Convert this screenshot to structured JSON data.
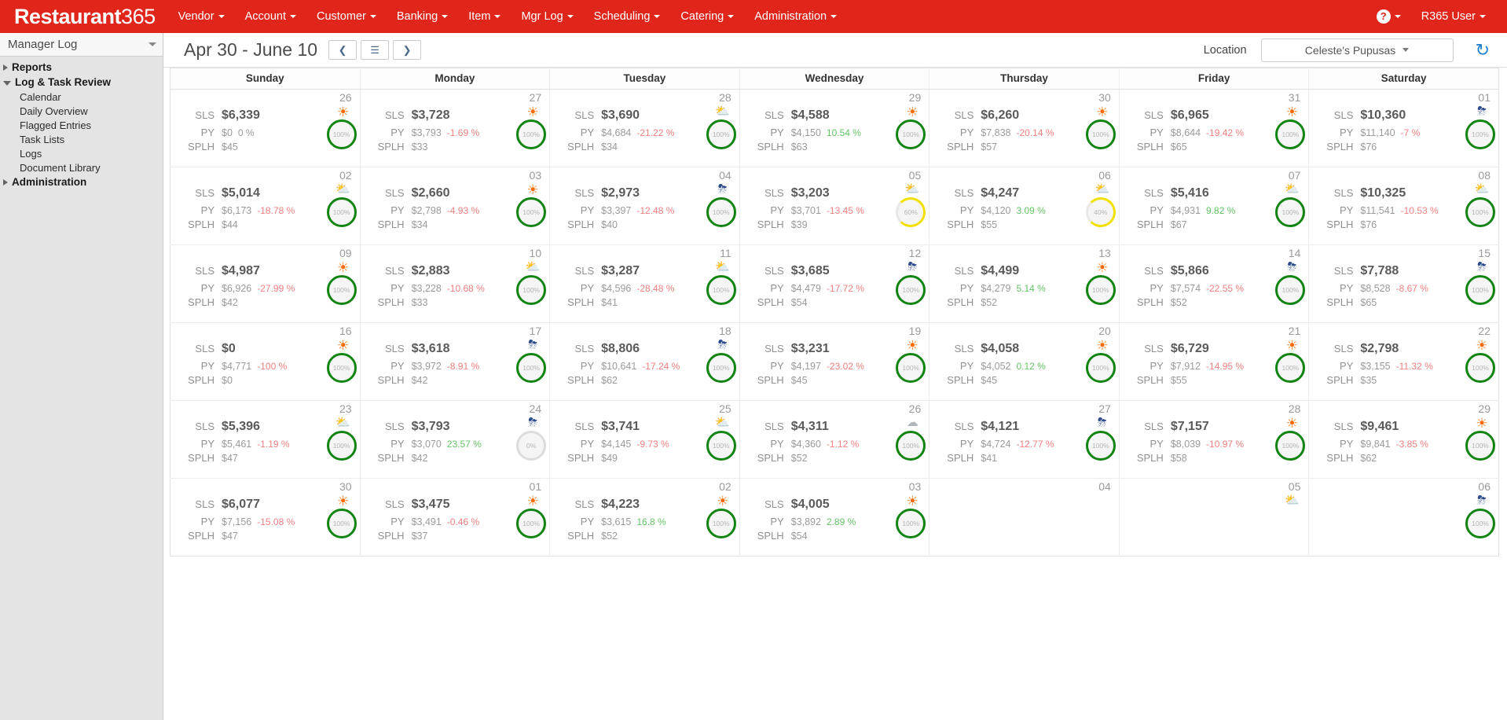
{
  "brand": {
    "bold": "Restaurant",
    "light": "365"
  },
  "topnav": {
    "items": [
      {
        "label": "Vendor"
      },
      {
        "label": "Account"
      },
      {
        "label": "Customer"
      },
      {
        "label": "Banking"
      },
      {
        "label": "Item"
      },
      {
        "label": "Mgr Log"
      },
      {
        "label": "Scheduling"
      },
      {
        "label": "Catering"
      },
      {
        "label": "Administration"
      }
    ],
    "help_glyph": "?",
    "user": "R365 User"
  },
  "sidebar": {
    "module": "Manager Log",
    "tree": [
      {
        "label": "Reports",
        "type": "group",
        "open": false
      },
      {
        "label": "Log & Task Review",
        "type": "group",
        "open": true
      },
      {
        "label": "Calendar",
        "type": "child"
      },
      {
        "label": "Daily Overview",
        "type": "child"
      },
      {
        "label": "Flagged Entries",
        "type": "child"
      },
      {
        "label": "Task Lists",
        "type": "child"
      },
      {
        "label": "Logs",
        "type": "child"
      },
      {
        "label": "Document Library",
        "type": "child"
      },
      {
        "label": "Administration",
        "type": "group",
        "open": false
      }
    ]
  },
  "toolbar": {
    "date_range": "Apr 30 - June 10",
    "prev_glyph": "❮",
    "calendar_glyph": "☰",
    "next_glyph": "❯",
    "location_label": "Location",
    "location_value": "Celeste's Pupusas",
    "refresh_glyph": "↻"
  },
  "calendar": {
    "day_headers": [
      "Sunday",
      "Monday",
      "Tuesday",
      "Wednesday",
      "Thursday",
      "Friday",
      "Saturday"
    ],
    "labels": {
      "sls": "SLS",
      "py": "PY",
      "splh": "SPLH"
    },
    "weeks": [
      [
        {
          "day": "26",
          "wx": "sun",
          "ring": "green",
          "ring_text": "100%",
          "sls": "$6,339",
          "py": "$0",
          "pct": "0 %",
          "pct_dir": "zero",
          "splh": "$45"
        },
        {
          "day": "27",
          "wx": "sun",
          "ring": "green",
          "ring_text": "100%",
          "sls": "$3,728",
          "py": "$3,793",
          "pct": "-1.69 %",
          "pct_dir": "neg",
          "splh": "$33"
        },
        {
          "day": "28",
          "wx": "cloud-sun",
          "ring": "green",
          "ring_text": "100%",
          "sls": "$3,690",
          "py": "$4,684",
          "pct": "-21.22 %",
          "pct_dir": "neg",
          "splh": "$34"
        },
        {
          "day": "29",
          "wx": "sun",
          "ring": "green",
          "ring_text": "100%",
          "sls": "$4,588",
          "py": "$4,150",
          "pct": "10.54 %",
          "pct_dir": "pos",
          "splh": "$63"
        },
        {
          "day": "30",
          "wx": "sun",
          "ring": "green",
          "ring_text": "100%",
          "sls": "$6,260",
          "py": "$7,838",
          "pct": "-20.14 %",
          "pct_dir": "neg",
          "splh": "$57"
        },
        {
          "day": "31",
          "wx": "sun",
          "ring": "green",
          "ring_text": "100%",
          "sls": "$6,965",
          "py": "$8,644",
          "pct": "-19.42 %",
          "pct_dir": "neg",
          "splh": "$65"
        },
        {
          "day": "01",
          "wx": "rain-sun",
          "ring": "green",
          "ring_text": "100%",
          "sls": "$10,360",
          "py": "$11,140",
          "pct": "-7 %",
          "pct_dir": "neg",
          "splh": "$76"
        }
      ],
      [
        {
          "day": "02",
          "wx": "cloud-sun",
          "ring": "green",
          "ring_text": "100%",
          "sls": "$5,014",
          "py": "$6,173",
          "pct": "-18.78 %",
          "pct_dir": "neg",
          "splh": "$44"
        },
        {
          "day": "03",
          "wx": "sun",
          "ring": "green",
          "ring_text": "100%",
          "sls": "$2,660",
          "py": "$2,798",
          "pct": "-4.93 %",
          "pct_dir": "neg",
          "splh": "$34"
        },
        {
          "day": "04",
          "wx": "rain-sun",
          "ring": "green",
          "ring_text": "100%",
          "sls": "$2,973",
          "py": "$3,397",
          "pct": "-12.48 %",
          "pct_dir": "neg",
          "splh": "$40"
        },
        {
          "day": "05",
          "wx": "cloud-sun",
          "ring": "yellow",
          "ring_text": "60%",
          "sls": "$3,203",
          "py": "$3,701",
          "pct": "-13.45 %",
          "pct_dir": "neg",
          "splh": "$39"
        },
        {
          "day": "06",
          "wx": "cloud-sun",
          "ring": "yellow",
          "ring_text": "40%",
          "sls": "$4,247",
          "py": "$4,120",
          "pct": "3.09 %",
          "pct_dir": "pos",
          "splh": "$55"
        },
        {
          "day": "07",
          "wx": "cloud-sun",
          "ring": "green",
          "ring_text": "100%",
          "sls": "$5,416",
          "py": "$4,931",
          "pct": "9.82 %",
          "pct_dir": "pos",
          "splh": "$67"
        },
        {
          "day": "08",
          "wx": "cloud-sun",
          "ring": "green",
          "ring_text": "100%",
          "sls": "$10,325",
          "py": "$11,541",
          "pct": "-10.53 %",
          "pct_dir": "neg",
          "splh": "$76"
        }
      ],
      [
        {
          "day": "09",
          "wx": "sun",
          "ring": "green",
          "ring_text": "100%",
          "sls": "$4,987",
          "py": "$6,926",
          "pct": "-27.99 %",
          "pct_dir": "neg",
          "splh": "$42"
        },
        {
          "day": "10",
          "wx": "cloud-sun",
          "ring": "green",
          "ring_text": "100%",
          "sls": "$2,883",
          "py": "$3,228",
          "pct": "-10.68 %",
          "pct_dir": "neg",
          "splh": "$33"
        },
        {
          "day": "11",
          "wx": "cloud-sun",
          "ring": "green",
          "ring_text": "100%",
          "sls": "$3,287",
          "py": "$4,596",
          "pct": "-28.48 %",
          "pct_dir": "neg",
          "splh": "$41"
        },
        {
          "day": "12",
          "wx": "rain-sun",
          "ring": "green",
          "ring_text": "100%",
          "sls": "$3,685",
          "py": "$4,479",
          "pct": "-17.72 %",
          "pct_dir": "neg",
          "splh": "$54"
        },
        {
          "day": "13",
          "wx": "sun",
          "ring": "green",
          "ring_text": "100%",
          "sls": "$4,499",
          "py": "$4,279",
          "pct": "5.14 %",
          "pct_dir": "pos",
          "splh": "$52"
        },
        {
          "day": "14",
          "wx": "rain-sun",
          "ring": "green",
          "ring_text": "100%",
          "sls": "$5,866",
          "py": "$7,574",
          "pct": "-22.55 %",
          "pct_dir": "neg",
          "splh": "$52"
        },
        {
          "day": "15",
          "wx": "rain-sun",
          "ring": "green",
          "ring_text": "100%",
          "sls": "$7,788",
          "py": "$8,528",
          "pct": "-8.67 %",
          "pct_dir": "neg",
          "splh": "$65"
        }
      ],
      [
        {
          "day": "16",
          "wx": "sun",
          "ring": "green",
          "ring_text": "100%",
          "sls": "$0",
          "py": "$4,771",
          "pct": "-100 %",
          "pct_dir": "neg",
          "splh": "$0"
        },
        {
          "day": "17",
          "wx": "rain-sun",
          "ring": "green",
          "ring_text": "100%",
          "sls": "$3,618",
          "py": "$3,972",
          "pct": "-8.91 %",
          "pct_dir": "neg",
          "splh": "$42"
        },
        {
          "day": "18",
          "wx": "rain-sun",
          "ring": "green",
          "ring_text": "100%",
          "sls": "$8,806",
          "py": "$10,641",
          "pct": "-17.24 %",
          "pct_dir": "neg",
          "splh": "$62"
        },
        {
          "day": "19",
          "wx": "sun",
          "ring": "green",
          "ring_text": "100%",
          "sls": "$3,231",
          "py": "$4,197",
          "pct": "-23.02 %",
          "pct_dir": "neg",
          "splh": "$45"
        },
        {
          "day": "20",
          "wx": "sun",
          "ring": "green",
          "ring_text": "100%",
          "sls": "$4,058",
          "py": "$4,052",
          "pct": "0.12 %",
          "pct_dir": "pos",
          "splh": "$45"
        },
        {
          "day": "21",
          "wx": "sun",
          "ring": "green",
          "ring_text": "100%",
          "sls": "$6,729",
          "py": "$7,912",
          "pct": "-14.95 %",
          "pct_dir": "neg",
          "splh": "$55"
        },
        {
          "day": "22",
          "wx": "sun",
          "ring": "green",
          "ring_text": "100%",
          "sls": "$2,798",
          "py": "$3,155",
          "pct": "-11.32 %",
          "pct_dir": "neg",
          "splh": "$35"
        }
      ],
      [
        {
          "day": "23",
          "wx": "cloud-sun",
          "ring": "green",
          "ring_text": "100%",
          "sls": "$5,396",
          "py": "$5,461",
          "pct": "-1.19 %",
          "pct_dir": "neg",
          "splh": "$47"
        },
        {
          "day": "24",
          "wx": "rain-sun",
          "ring": "gray",
          "ring_text": "0%",
          "sls": "$3,793",
          "py": "$3,070",
          "pct": "23.57 %",
          "pct_dir": "pos",
          "splh": "$42"
        },
        {
          "day": "25",
          "wx": "cloud-sun",
          "ring": "green",
          "ring_text": "100%",
          "sls": "$3,741",
          "py": "$4,145",
          "pct": "-9.73 %",
          "pct_dir": "neg",
          "splh": "$49"
        },
        {
          "day": "26",
          "wx": "cloud",
          "ring": "green",
          "ring_text": "100%",
          "sls": "$4,311",
          "py": "$4,360",
          "pct": "-1.12 %",
          "pct_dir": "neg",
          "splh": "$52"
        },
        {
          "day": "27",
          "wx": "rain-sun",
          "ring": "green",
          "ring_text": "100%",
          "sls": "$4,121",
          "py": "$4,724",
          "pct": "-12.77 %",
          "pct_dir": "neg",
          "splh": "$41"
        },
        {
          "day": "28",
          "wx": "sun",
          "ring": "green",
          "ring_text": "100%",
          "sls": "$7,157",
          "py": "$8,039",
          "pct": "-10.97 %",
          "pct_dir": "neg",
          "splh": "$58"
        },
        {
          "day": "29",
          "wx": "sun",
          "ring": "green",
          "ring_text": "100%",
          "sls": "$9,461",
          "py": "$9,841",
          "pct": "-3.85 %",
          "pct_dir": "neg",
          "splh": "$62"
        }
      ],
      [
        {
          "day": "30",
          "wx": "sun",
          "ring": "green",
          "ring_text": "100%",
          "sls": "$6,077",
          "py": "$7,156",
          "pct": "-15.08 %",
          "pct_dir": "neg",
          "splh": "$47"
        },
        {
          "day": "01",
          "wx": "sun",
          "ring": "green",
          "ring_text": "100%",
          "sls": "$3,475",
          "py": "$3,491",
          "pct": "-0.46 %",
          "pct_dir": "neg",
          "splh": "$37"
        },
        {
          "day": "02",
          "wx": "sun",
          "ring": "green",
          "ring_text": "100%",
          "sls": "$4,223",
          "py": "$3,615",
          "pct": "16.8 %",
          "pct_dir": "pos",
          "splh": "$52"
        },
        {
          "day": "03",
          "wx": "sun",
          "ring": "green",
          "ring_text": "100%",
          "sls": "$4,005",
          "py": "$3,892",
          "pct": "2.89 %",
          "pct_dir": "pos",
          "splh": "$54"
        },
        {
          "day": "04",
          "wx": "none",
          "ring": "blank",
          "ring_text": "",
          "sls": "",
          "py": "",
          "pct": "",
          "pct_dir": "zero",
          "splh": "",
          "empty": true
        },
        {
          "day": "05",
          "wx": "cloud-sun",
          "ring": "blank",
          "ring_text": "",
          "sls": "",
          "py": "",
          "pct": "",
          "pct_dir": "zero",
          "splh": "",
          "empty": true
        },
        {
          "day": "06",
          "wx": "rain-sun",
          "ring": "green",
          "ring_text": "100%",
          "sls": "",
          "py": "",
          "pct": "",
          "pct_dir": "zero",
          "splh": "",
          "empty": true
        }
      ]
    ]
  },
  "colors": {
    "brand_red": "#e0251b",
    "ring_green": "#128412",
    "ring_yellow": "#f2e000",
    "negative": "#f08080",
    "positive": "#63c463",
    "sidebar_bg": "#e4e4e4"
  }
}
